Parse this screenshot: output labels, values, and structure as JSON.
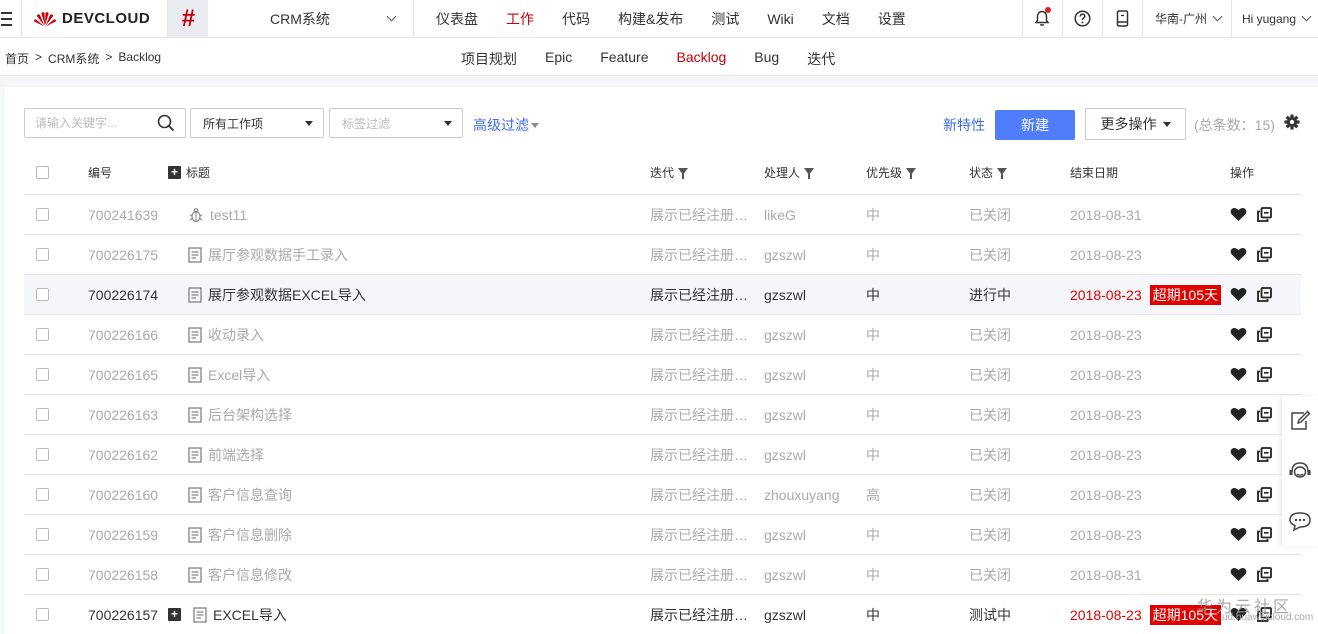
{
  "header": {
    "logo_text": "DEVCLOUD",
    "project_name": "CRM系统",
    "nav": [
      "仪表盘",
      "工作",
      "代码",
      "构建&发布",
      "测试",
      "Wiki",
      "文档",
      "设置"
    ],
    "active_nav": "工作",
    "region": "华南-广州",
    "user": "Hi yugang"
  },
  "subnav": {
    "breadcrumb": [
      "首页",
      ">",
      "CRM系统",
      ">",
      "Backlog"
    ],
    "tabs": [
      "项目规划",
      "Epic",
      "Feature",
      "Backlog",
      "Bug",
      "迭代"
    ],
    "active_tab": "Backlog"
  },
  "toolbar": {
    "search_placeholder": "请输入关键字...",
    "work_item_select": "所有工作项",
    "tag_filter_placeholder": "标签过滤",
    "advanced_filter": "高级过滤",
    "new_feature": "新特性",
    "new_button": "新建",
    "more_actions": "更多操作",
    "total": "(总条数：15)"
  },
  "table": {
    "columns": [
      "编号",
      "标题",
      "迭代",
      "处理人",
      "优先级",
      "状态",
      "结束日期",
      "操作"
    ],
    "rows": [
      {
        "id": "700241639",
        "title": "test11",
        "type": "bug",
        "iteration": "展示已经注册…",
        "assignee": "likeG",
        "priority": "中",
        "status": "已关闭",
        "end_date": "2018-08-31",
        "overdue": "",
        "active": false,
        "expandable": false
      },
      {
        "id": "700226175",
        "title": "展厅参观数据手工录入",
        "type": "doc",
        "iteration": "展示已经注册…",
        "assignee": "gzszwl",
        "priority": "中",
        "status": "已关闭",
        "end_date": "2018-08-23",
        "overdue": "",
        "active": false,
        "expandable": false
      },
      {
        "id": "700226174",
        "title": "展厅参观数据EXCEL导入",
        "type": "doc",
        "iteration": "展示已经注册…",
        "assignee": "gzszwl",
        "priority": "中",
        "status": "进行中",
        "end_date": "2018-08-23",
        "overdue": "超期105天",
        "active": true,
        "expandable": false
      },
      {
        "id": "700226166",
        "title": "收动录入",
        "type": "doc",
        "iteration": "展示已经注册…",
        "assignee": "gzszwl",
        "priority": "中",
        "status": "已关闭",
        "end_date": "2018-08-23",
        "overdue": "",
        "active": false,
        "expandable": false
      },
      {
        "id": "700226165",
        "title": "Excel导入",
        "type": "doc",
        "iteration": "展示已经注册…",
        "assignee": "gzszwl",
        "priority": "中",
        "status": "已关闭",
        "end_date": "2018-08-23",
        "overdue": "",
        "active": false,
        "expandable": false
      },
      {
        "id": "700226163",
        "title": "后台架构选择",
        "type": "doc",
        "iteration": "展示已经注册…",
        "assignee": "gzszwl",
        "priority": "中",
        "status": "已关闭",
        "end_date": "2018-08-23",
        "overdue": "",
        "active": false,
        "expandable": false
      },
      {
        "id": "700226162",
        "title": "前端选择",
        "type": "doc",
        "iteration": "展示已经注册…",
        "assignee": "gzszwl",
        "priority": "中",
        "status": "已关闭",
        "end_date": "2018-08-23",
        "overdue": "",
        "active": false,
        "expandable": false
      },
      {
        "id": "700226160",
        "title": "客户信息查询",
        "type": "doc",
        "iteration": "展示已经注册…",
        "assignee": "zhouxuyang",
        "priority": "高",
        "status": "已关闭",
        "end_date": "2018-08-23",
        "overdue": "",
        "active": false,
        "expandable": false
      },
      {
        "id": "700226159",
        "title": "客户信息删除",
        "type": "doc",
        "iteration": "展示已经注册…",
        "assignee": "gzszwl",
        "priority": "中",
        "status": "已关闭",
        "end_date": "2018-08-23",
        "overdue": "",
        "active": false,
        "expandable": false
      },
      {
        "id": "700226158",
        "title": "客户信息修改",
        "type": "doc",
        "iteration": "展示已经注册…",
        "assignee": "gzszwl",
        "priority": "中",
        "status": "已关闭",
        "end_date": "2018-08-31",
        "overdue": "",
        "active": false,
        "expandable": false
      },
      {
        "id": "700226157",
        "title": "EXCEL导入",
        "type": "doc",
        "iteration": "展示已经注册…",
        "assignee": "gzszwl",
        "priority": "中",
        "status": "测试中",
        "end_date": "2018-08-23",
        "overdue": "超期105天",
        "active": true,
        "expandable": true
      }
    ]
  },
  "watermark": {
    "text": "华为云社区",
    "url_text": "ud.huaweicloud.com"
  },
  "colors": {
    "brand_red": "#c7000b",
    "primary_blue": "#4f7dfb",
    "link_blue": "#3f6ee8",
    "overdue_red": "#e00000"
  }
}
